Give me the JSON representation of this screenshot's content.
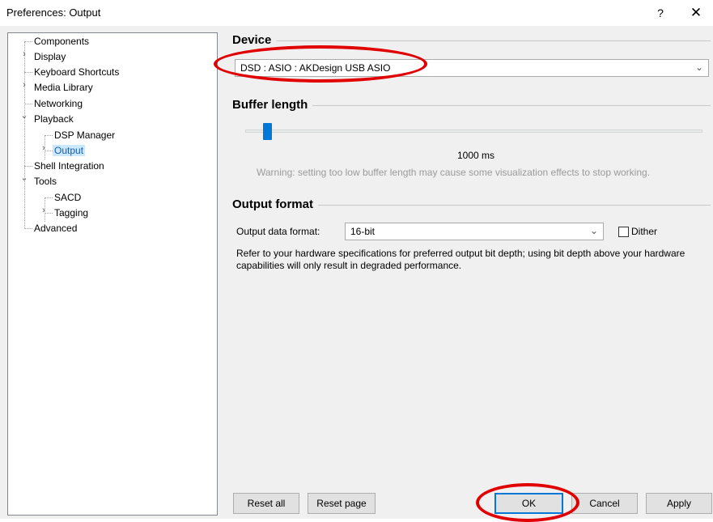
{
  "window": {
    "title": "Preferences: Output",
    "help_glyph": "?",
    "close_glyph": "✕"
  },
  "tree": {
    "items": [
      {
        "id": "components",
        "label": "Components"
      },
      {
        "id": "display",
        "label": "Display"
      },
      {
        "id": "keyboard-shortcuts",
        "label": "Keyboard Shortcuts"
      },
      {
        "id": "media-library",
        "label": "Media Library"
      },
      {
        "id": "networking",
        "label": "Networking"
      },
      {
        "id": "playback",
        "label": "Playback"
      },
      {
        "id": "dsp-manager",
        "label": "DSP Manager"
      },
      {
        "id": "output",
        "label": "Output",
        "selected": true
      },
      {
        "id": "shell-integration",
        "label": "Shell Integration"
      },
      {
        "id": "tools",
        "label": "Tools"
      },
      {
        "id": "sacd",
        "label": "SACD"
      },
      {
        "id": "tagging",
        "label": "Tagging"
      },
      {
        "id": "advanced",
        "label": "Advanced"
      }
    ],
    "collapsed_glyph": "›",
    "expanded_glyph": "⌄"
  },
  "device": {
    "section_title": "Device",
    "selected": "DSD : ASIO : AKDesign USB ASIO"
  },
  "buffer": {
    "section_title": "Buffer length",
    "value_label": "1000 ms",
    "slider_fraction": 0.04,
    "warning": "Warning: setting too low buffer length may cause some visualization effects to stop working."
  },
  "output_format": {
    "section_title": "Output format",
    "format_label": "Output data format:",
    "format_value": "16-bit",
    "dither_label": "Dither",
    "dither_checked": false,
    "note": "Refer to your hardware specifications for preferred output bit depth; using bit depth above your hardware capabilities will only result in degraded performance."
  },
  "buttons": {
    "reset_all": "Reset all",
    "reset_page": "Reset page",
    "ok": "OK",
    "cancel": "Cancel",
    "apply": "Apply"
  },
  "colors": {
    "accent": "#0078d7",
    "annotation": "#e10000",
    "selection": "#cce8ff"
  },
  "icons": {
    "dropdown": "chevron-down-icon",
    "expand": "chevron-right-icon",
    "collapse": "chevron-down-icon"
  }
}
